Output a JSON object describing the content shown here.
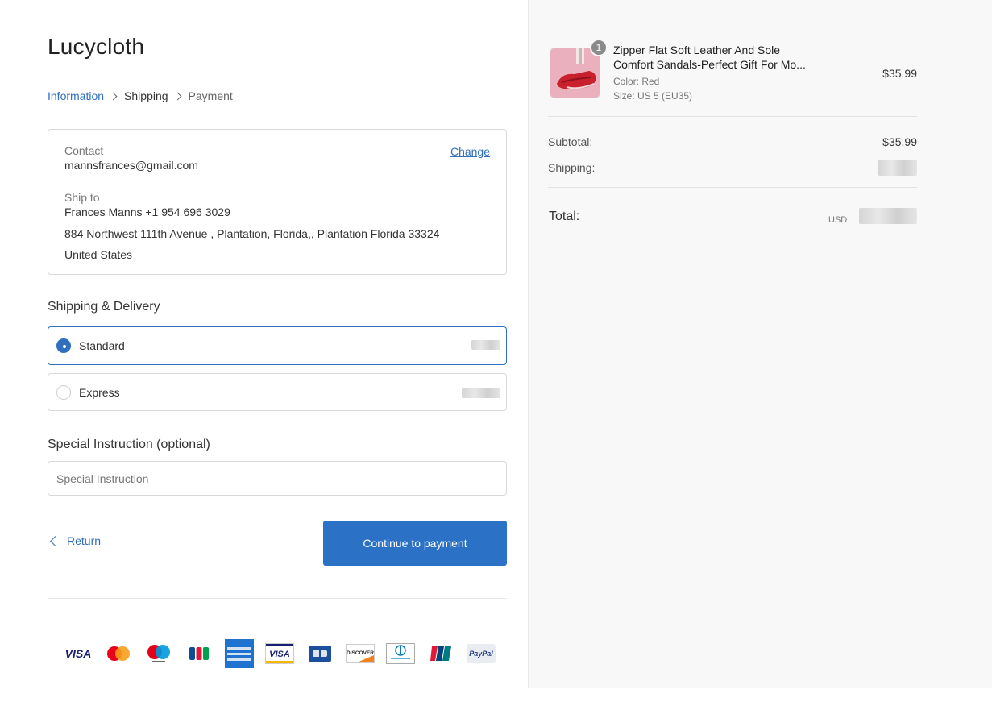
{
  "brand": "Lucycloth",
  "breadcrumb": {
    "step1": "Information",
    "step2": "Shipping",
    "step3": "Payment"
  },
  "contact": {
    "label": "Contact",
    "value": "mannsfrances@gmail.com",
    "change": "Change"
  },
  "ship_to": {
    "label": "Ship to",
    "name_phone": "Frances  Manns  +1 954 696 3029",
    "address": "884 Northwest 111th Avenue , Plantation, Florida,, Plantation   Florida   33324",
    "country": "United States"
  },
  "shipping": {
    "title": "Shipping & Delivery",
    "options": [
      {
        "label": "Standard",
        "selected": true
      },
      {
        "label": "Express",
        "selected": false
      }
    ]
  },
  "instruction": {
    "title": "Special Instruction (optional)",
    "placeholder": "Special Instruction"
  },
  "actions": {
    "return": "Return",
    "continue": "Continue to payment"
  },
  "payment_icons": [
    "visa-icon",
    "mastercard-icon",
    "maestro-icon",
    "jcb-icon",
    "amex-icon",
    "visa-electron-icon",
    "cb-icon",
    "discover-icon",
    "diners-club-icon",
    "unionpay-icon",
    "paypal-icon"
  ],
  "cart": {
    "qty": "1",
    "name": "Zipper Flat Soft Leather And Sole Comfort Sandals-Perfect Gift For Mo...",
    "color": "Color:  Red",
    "size": "Size:  US 5 (EU35)",
    "price": "$35.99"
  },
  "summary": {
    "subtotal_label": "Subtotal:",
    "subtotal": "$35.99",
    "shipping_label": "Shipping:",
    "total_label": "Total:",
    "currency": "USD"
  },
  "colors": {
    "accent": "#2b71c6",
    "link": "#2f6fbd",
    "panel": "#f8f8f8"
  }
}
